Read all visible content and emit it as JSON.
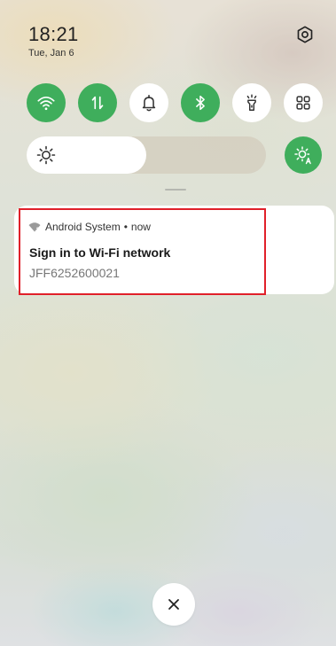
{
  "status": {
    "time": "18:21",
    "date": "Tue, Jan 6"
  },
  "quick_settings": {
    "tiles": [
      {
        "name": "wifi",
        "icon": "wifi-icon",
        "active": true
      },
      {
        "name": "mobile-data",
        "icon": "mobile-data-icon",
        "active": true
      },
      {
        "name": "sound",
        "icon": "bell-icon",
        "active": false
      },
      {
        "name": "bluetooth",
        "icon": "bluetooth-icon",
        "active": true
      },
      {
        "name": "flashlight",
        "icon": "flashlight-icon",
        "active": false
      },
      {
        "name": "edit-tiles",
        "icon": "grid-icon",
        "active": false
      }
    ],
    "brightness_level": 0.5,
    "auto_brightness": true
  },
  "notification": {
    "app_name": "Android System",
    "separator": "•",
    "time": "now",
    "title": "Sign in to Wi-Fi network",
    "body": "JFF6252600021"
  },
  "colors": {
    "accent": "#3fae5c",
    "highlight": "#e0202a",
    "tile_off": "#ffffff"
  }
}
